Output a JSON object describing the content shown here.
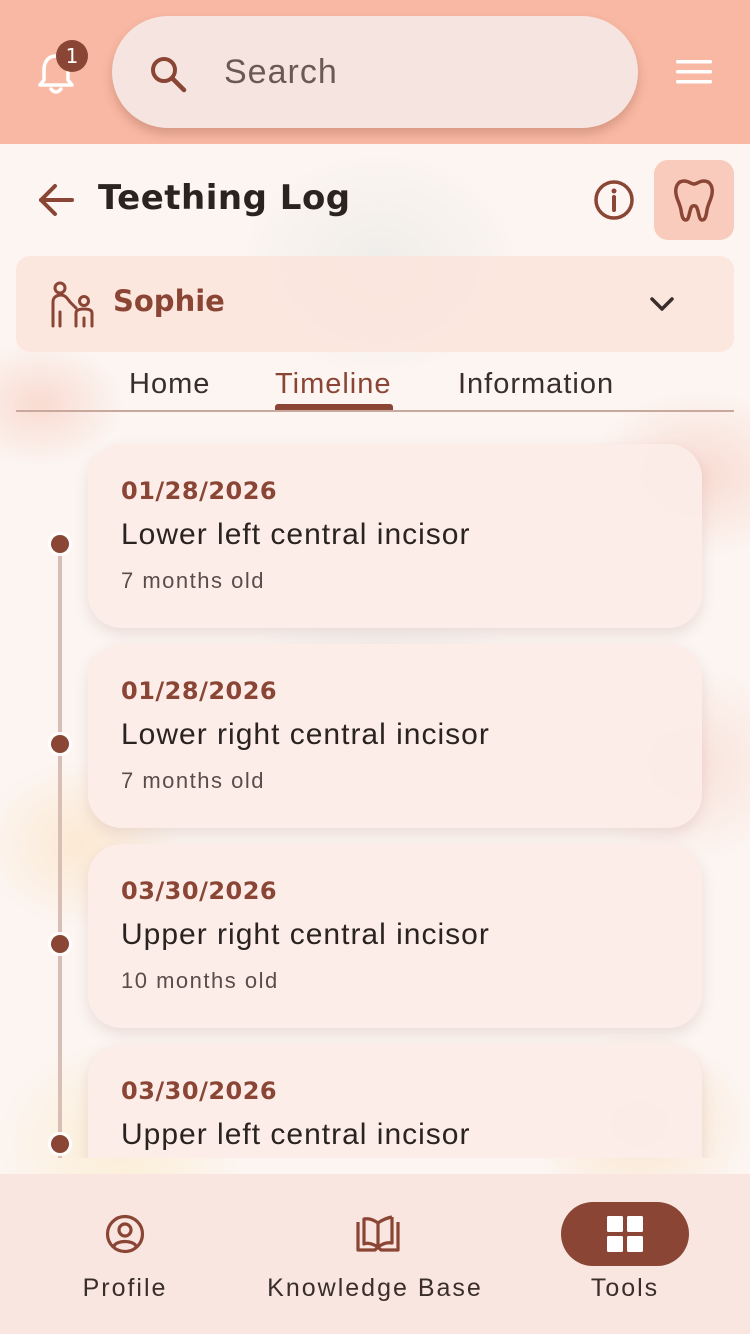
{
  "topbar": {
    "notification_count": "1",
    "search_placeholder": "Search",
    "bell_icon": "bell-icon",
    "menu_icon": "hamburger-menu-icon"
  },
  "header": {
    "title": "Teething Log",
    "back_icon": "arrow-left-icon",
    "info_icon": "info-icon",
    "tooth_icon": "tooth-icon"
  },
  "child": {
    "name": "Sophie",
    "icon": "parent-child-icon"
  },
  "tabs": [
    {
      "label": "Home",
      "active": false
    },
    {
      "label": "Timeline",
      "active": true
    },
    {
      "label": "Information",
      "active": false
    }
  ],
  "timeline": [
    {
      "date": "01/28/2026",
      "tooth": "Lower left central incisor",
      "age": "7 months old"
    },
    {
      "date": "01/28/2026",
      "tooth": "Lower right central incisor",
      "age": "7 months old"
    },
    {
      "date": "03/30/2026",
      "tooth": "Upper right central incisor",
      "age": "10 months old"
    },
    {
      "date": "03/30/2026",
      "tooth": "Upper left central incisor",
      "age": ""
    }
  ],
  "bottom_nav": [
    {
      "label": "Profile",
      "icon": "user-circle-icon",
      "active": false
    },
    {
      "label": "Knowledge Base",
      "icon": "book-open-icon",
      "active": false
    },
    {
      "label": "Tools",
      "icon": "grid-icon",
      "active": true
    }
  ],
  "colors": {
    "accent": "#8a4535",
    "topbar": "#f8b8a3",
    "card": "#fcece8"
  }
}
